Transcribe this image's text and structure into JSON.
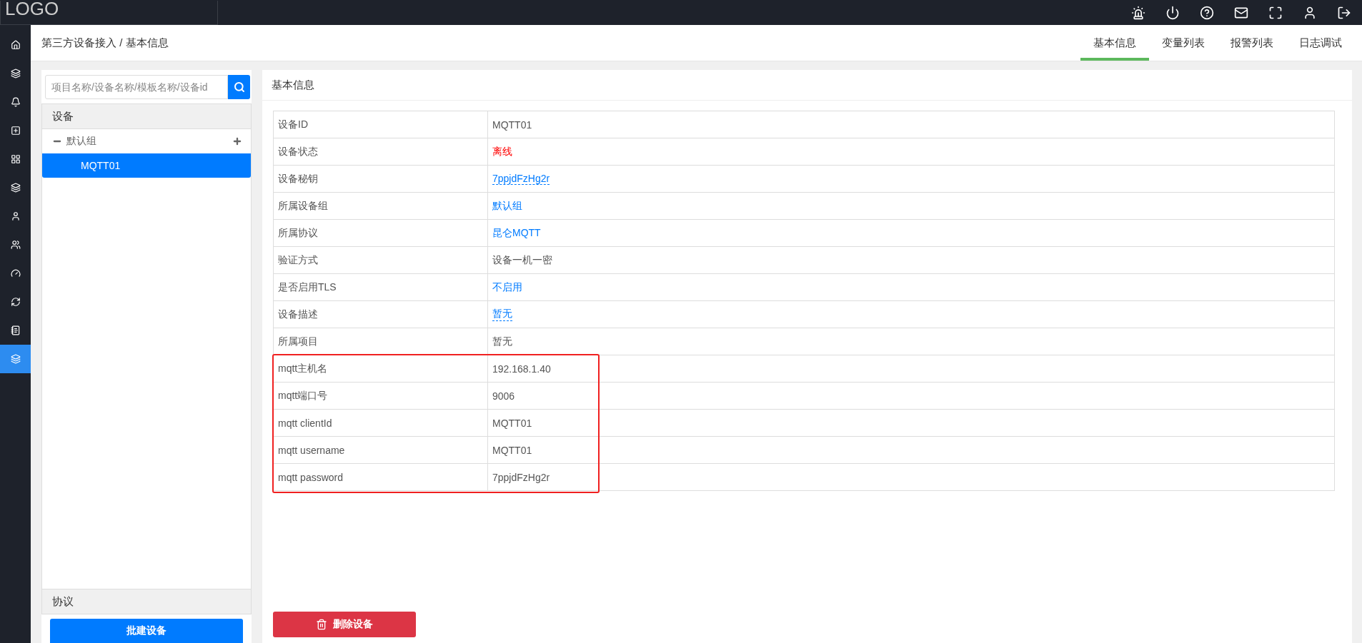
{
  "logo": "LOGO",
  "nav_items": [
    {
      "selected": false
    },
    {
      "selected": false
    },
    {
      "selected": false
    },
    {
      "selected": false
    },
    {
      "selected": false
    },
    {
      "selected": false
    },
    {
      "selected": false
    },
    {
      "selected": false
    },
    {
      "selected": false
    },
    {
      "selected": false
    },
    {
      "selected": false
    },
    {
      "selected": true
    }
  ],
  "breadcrumb": "第三方设备接入 / 基本信息",
  "tabs": [
    {
      "label": "基本信息",
      "selected": true
    },
    {
      "label": "变量列表",
      "selected": false
    },
    {
      "label": "报警列表",
      "selected": false
    },
    {
      "label": "日志调试",
      "selected": false
    }
  ],
  "search": {
    "placeholder": "项目名称/设备名称/模板名称/设备id"
  },
  "device_section": {
    "title": "设备",
    "tree": [
      {
        "label": "默认组",
        "expanded": true,
        "children": [
          {
            "label": "MQTT01",
            "selected": true
          }
        ]
      }
    ]
  },
  "protocol_section": {
    "title": "协议"
  },
  "batch_button": "批建设备",
  "panel_title": "基本信息",
  "rows": [
    {
      "label": "设备ID",
      "value": "MQTT01",
      "kind": "text"
    },
    {
      "label": "设备状态",
      "value": "离线",
      "kind": "status"
    },
    {
      "label": "设备秘钥",
      "value": "7ppjdFzHg2r",
      "kind": "editable"
    },
    {
      "label": "所属设备组",
      "value": "默认组",
      "kind": "link"
    },
    {
      "label": "所属协议",
      "value": "昆仑MQTT",
      "kind": "link"
    },
    {
      "label": "验证方式",
      "value": "设备一机一密",
      "kind": "text"
    },
    {
      "label": "是否启用TLS",
      "value": "不启用",
      "kind": "link"
    },
    {
      "label": "设备描述",
      "value": "暂无",
      "kind": "editable"
    },
    {
      "label": "所属项目",
      "value": "暂无",
      "kind": "text"
    }
  ],
  "highlighted_rows": [
    {
      "label": "mqtt主机名",
      "value": "192.168.1.40"
    },
    {
      "label": "mqtt端口号",
      "value": "9006"
    },
    {
      "label": "mqtt clientId",
      "value": "MQTT01"
    },
    {
      "label": "mqtt username",
      "value": "MQTT01"
    },
    {
      "label": "mqtt password",
      "value": "7ppjdFzHg2r"
    }
  ],
  "delete_button": "删除设备"
}
